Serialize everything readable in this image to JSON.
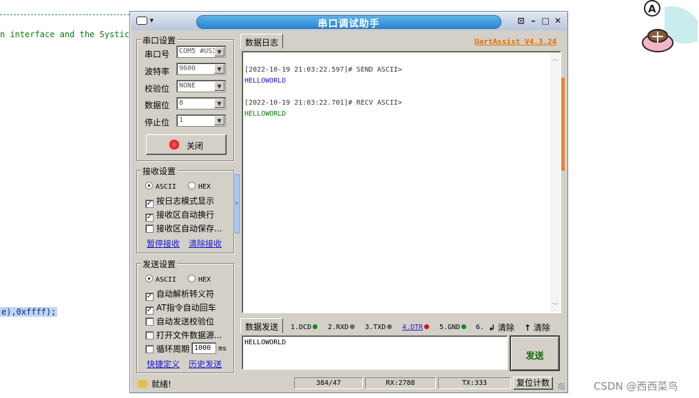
{
  "background": {
    "code_line_1": "n interface and the Systick.",
    "code_line_2": "e),0xffff);"
  },
  "window": {
    "title": "串口调试助手",
    "system_menu": "▾",
    "buttons": [
      "⊡",
      "–",
      "□",
      "✕"
    ]
  },
  "serial_settings": {
    "title": "串口设置",
    "port_label": "串口号",
    "port_value": "COM5 #USI",
    "baud_label": "波特率",
    "baud_value": "9600",
    "parity_label": "校验位",
    "parity_value": "NONE",
    "databits_label": "数据位",
    "databits_value": "8",
    "stopbits_label": "停止位",
    "stopbits_value": "1",
    "close_button": "关闭"
  },
  "receive_settings": {
    "title": "接收设置",
    "ascii": "ASCII",
    "hex": "HEX",
    "log_mode": "按日志模式显示",
    "auto_wrap": "接收区自动换行",
    "auto_save": "接收区自动保存...",
    "pause": "暂停接收",
    "clear": "清除接收"
  },
  "send_settings": {
    "title": "发送设置",
    "ascii": "ASCII",
    "hex": "HEX",
    "escape": "自动解析转义符",
    "at_crlf": "AT指令自动回车",
    "auto_checksum": "自动发送校验位",
    "open_file": "打开文件数据源...",
    "loop_period": "循环周期",
    "period_value": "1000",
    "period_unit": "ms",
    "shortcut": "快捷定义",
    "history": "历史发送"
  },
  "log": {
    "tab": "数据日志",
    "version": "UartAssist V4.3.24",
    "lines": [
      "[2022-10-19 21:03:22.597]# SEND ASCII>",
      "HELLOWORLD",
      "[2022-10-19 21:03:22.701]# RECV ASCII>",
      "HELLOWORLD"
    ]
  },
  "send": {
    "tab": "数据发送",
    "signals": [
      "1.DCD",
      "2.RXD",
      "3.TXD",
      "4.DTR",
      "5.GND",
      "6."
    ],
    "clear1": "清除",
    "clear2": "清除",
    "text": "HELLOWORLD",
    "button": "发送"
  },
  "status": {
    "ready": "就绪!",
    "position": "384/47",
    "rx": "RX:2788",
    "tx": "TX:333",
    "reset": "复位计数"
  },
  "watermark": "CSDN @西西菜鸟",
  "colors": {
    "title_bar": "#2a85cf",
    "send_text": "#1a1ad0",
    "recv_text": "#0a7a0a",
    "version": "#e07000"
  }
}
